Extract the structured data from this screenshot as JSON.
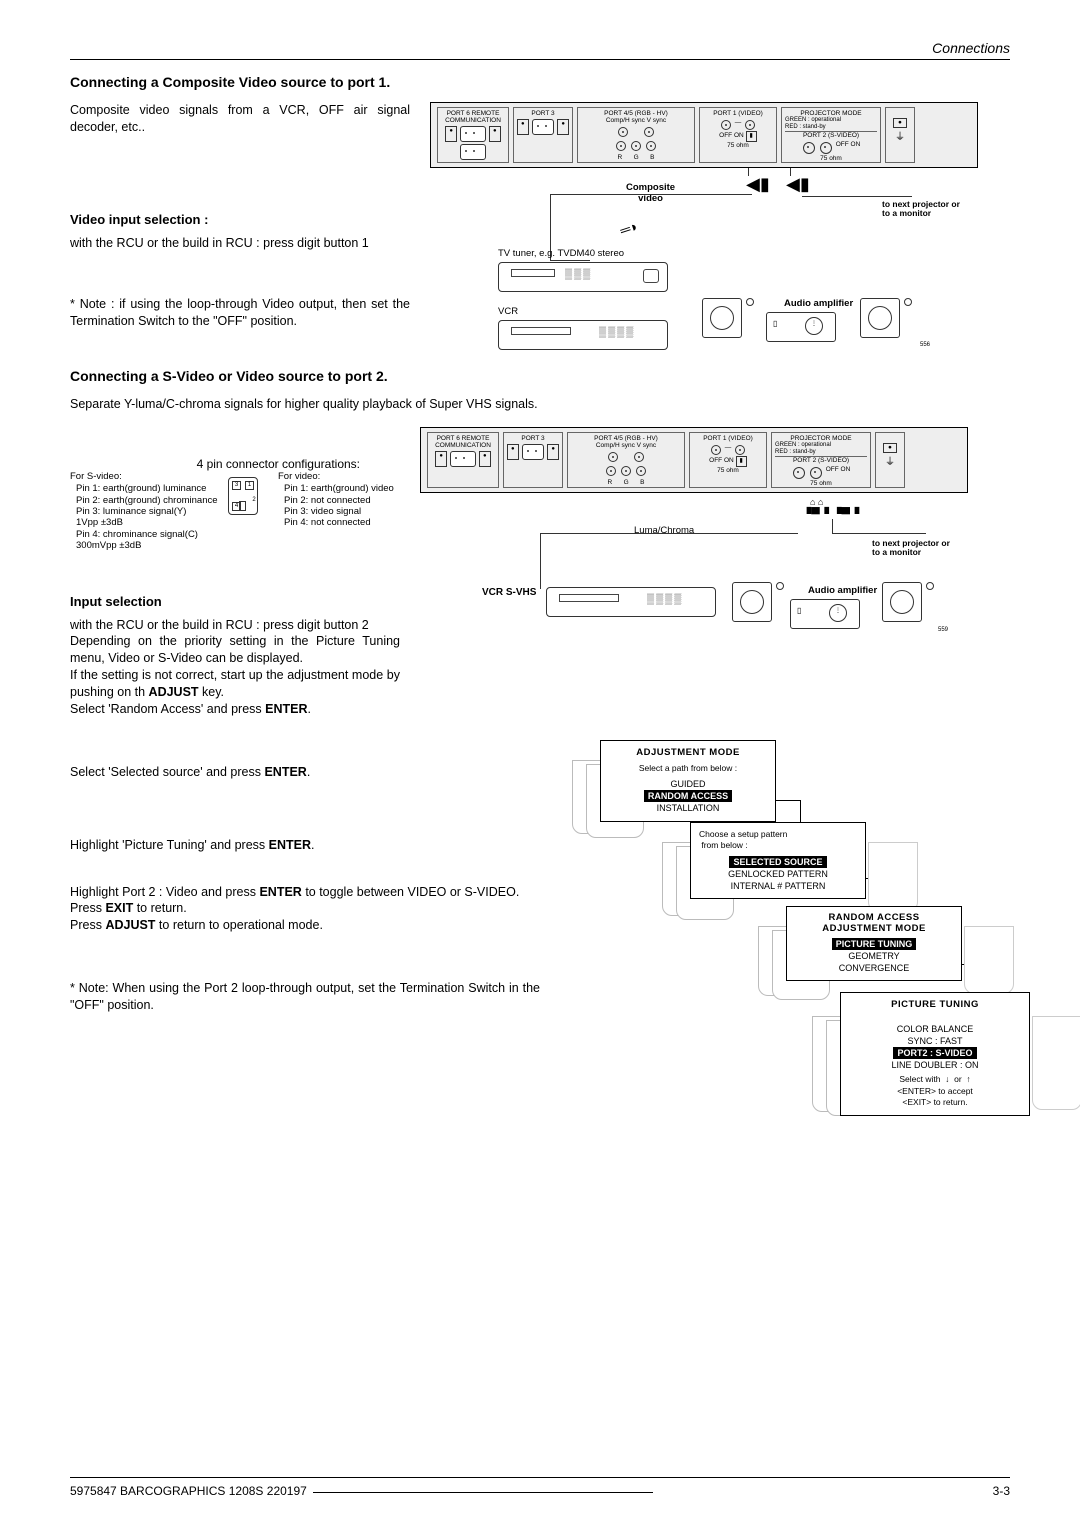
{
  "header_right": "Connections",
  "section1": {
    "title": "Connecting a Composite Video source to port 1.",
    "intro": "Composite video signals from a VCR, OFF air signal decoder, etc..",
    "sub1": "Video input selection :",
    "sub1_text": "with the RCU or the build in RCU : press digit button 1",
    "note": "* Note : if using the loop-through Video output, then set the Termination Switch to the \"OFF\" position."
  },
  "diagram1": {
    "composite_label": "Composite\nvideo",
    "to_next": "to next projector or\nto a monitor",
    "tv_tuner": "TV tuner, e.g. TVDM40 stereo",
    "vcr": "VCR",
    "audio_amp": "Audio amplifier",
    "num_right": "556"
  },
  "panel": {
    "port6": "PORT 6 REMOTE\nCOMMUNICATION",
    "port3": "PORT 3",
    "port45": "PORT 4/5\n(RGB - HV)",
    "sync": "Comp/H sync  V sync",
    "rgb": [
      "R",
      "G",
      "B"
    ],
    "port1": "PORT 1\n(VIDEO)",
    "offon": "OFF ON",
    "ohm": "75 ohm",
    "projmode": "PROJECTOR MODE",
    "green": "GREEN : operational",
    "red": "RED : stand-by",
    "port2": "PORT 2\n(S-VIDEO)"
  },
  "section2": {
    "title": "Connecting a S-Video or Video source to port 2.",
    "intro": "Separate Y-luma/C-chroma signals for higher quality playback of Super VHS signals.",
    "pin_title": "4 pin connector configurations:",
    "svideo": {
      "title": "For S-video:",
      "pins": [
        "Pin 1: earth(ground) luminance",
        "Pin 2: earth(ground) chrominance",
        "Pin 3: luminance signal(Y)",
        "          1Vpp ±3dB",
        "Pin 4: chrominance signal(C)",
        "          300mVpp ±3dB"
      ]
    },
    "video": {
      "title": "For video:",
      "pins": [
        "Pin 1: earth(ground) video",
        "Pin 2: not connected",
        "Pin 3: video signal",
        "Pin 4: not connected"
      ]
    },
    "luma": "Luma/Chroma",
    "vcr_svhs": "VCR S-VHS",
    "input_sel": "Input selection",
    "input_text": "with the RCU or the build in RCU : press digit button 2\nDepending on the priority setting in the Picture Tuning menu, Video or S-Video can be displayed.\nIf the setting is not correct, start up the adjustment mode by pushing on th ADJUST key.\nSelect 'Random Access' and press ENTER.",
    "step2": "Select  'Selected source' and press ENTER.",
    "step3": "Highlight 'Picture Tuning' and press ENTER.",
    "step4": "Highlight Port 2 : Video and press ENTER to toggle between VIDEO or S-VIDEO.\nPress EXIT to return.\nPress ADJUST to return to operational mode.",
    "note2": "* Note: When using the Port 2 loop-through output, set the Termination Switch in the \"OFF\" position.",
    "num_right2": "559"
  },
  "osd1": {
    "title": "ADJUSTMENT  MODE",
    "sub": "Select a path from below :",
    "items": [
      "GUIDED",
      "RANDOM ACCESS",
      "INSTALLATION"
    ]
  },
  "osd2": {
    "sub": "Choose a setup pattern\n from below :",
    "items": [
      "SELECTED SOURCE",
      "GENLOCKED PATTERN",
      "INTERNAL # PATTERN"
    ]
  },
  "osd3": {
    "title": "RANDOM ACCESS\nADJUSTMENT MODE",
    "items": [
      "PICTURE  TUNING",
      "GEOMETRY",
      "CONVERGENCE"
    ]
  },
  "osd4": {
    "title": "PICTURE  TUNING",
    "items": [
      "COLOR BALANCE",
      "SYNC : FAST",
      "PORT2 : S-VIDEO",
      "LINE DOUBLER : ON"
    ],
    "footer": "Select with  ↓  or  ↑\n<ENTER> to accept\n<EXIT> to return."
  },
  "footer": {
    "left": "5975847 BARCOGRAPHICS 1208S 220197",
    "right": "3-3"
  }
}
